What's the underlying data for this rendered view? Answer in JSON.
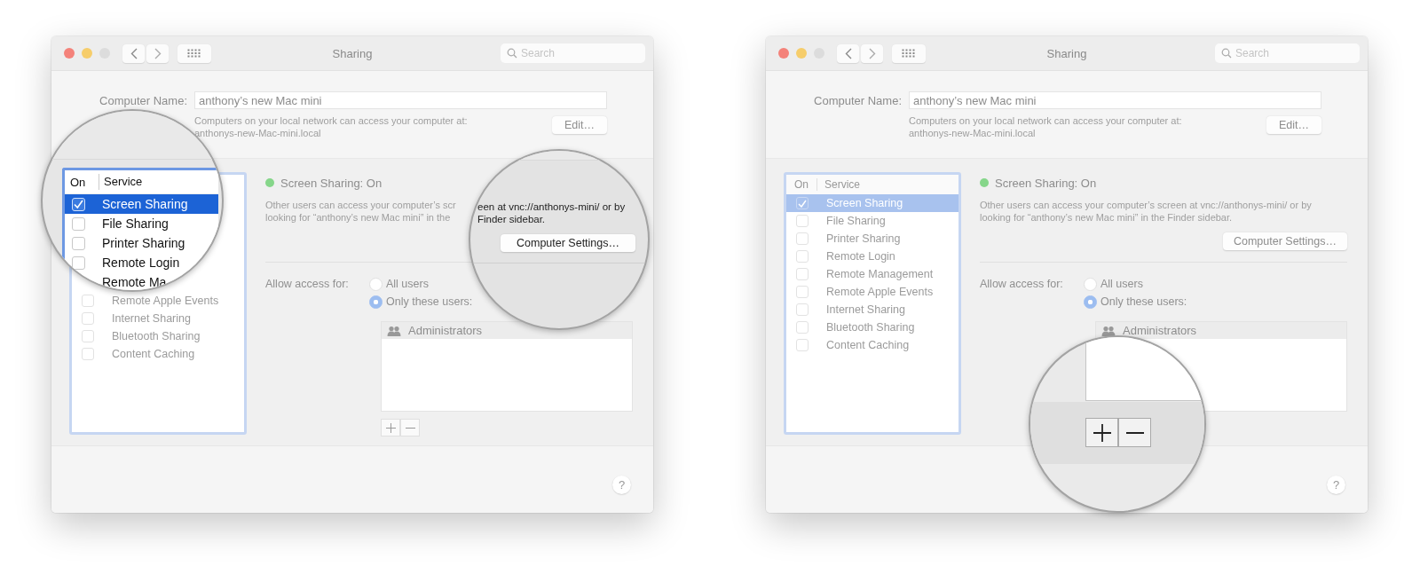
{
  "windows": [
    {
      "title": "Sharing",
      "search": {
        "placeholder": "Search"
      },
      "computer_name": {
        "label": "Computer Name:",
        "value": "anthony’s new Mac mini",
        "note_lines": [
          "Computers on your local network can access your computer at:",
          "anthonys-new-Mac-mini.local"
        ],
        "edit_button": "Edit…"
      },
      "services": {
        "items": [
          {
            "name": "Remote Apple Events",
            "checked": false,
            "selected": false
          },
          {
            "name": "Internet Sharing",
            "checked": false,
            "selected": false
          },
          {
            "name": "Bluetooth Sharing",
            "checked": false,
            "selected": false
          },
          {
            "name": "Content Caching",
            "checked": false,
            "selected": false
          }
        ]
      },
      "status": "Screen Sharing: On",
      "description_lines": [
        "Other users can access your computer’s scr",
        "looking for “anthony’s new Mac mini” in the"
      ],
      "access": {
        "label": "Allow access for:",
        "options": [
          {
            "label": "All users",
            "selected": false
          },
          {
            "label": "Only these users:",
            "selected": true
          }
        ]
      },
      "users": [
        {
          "name": "Administrators"
        }
      ],
      "help": "?",
      "magnifiers": [
        {
          "kind": "services",
          "columns": [
            "On",
            "Service"
          ],
          "items": [
            {
              "name": "Screen Sharing",
              "checked": true,
              "selected": true
            },
            {
              "name": "File Sharing",
              "checked": false,
              "selected": false
            },
            {
              "name": "Printer Sharing",
              "checked": false,
              "selected": false
            },
            {
              "name": "Remote Login",
              "checked": false,
              "selected": false
            },
            {
              "name": "Remote Ma",
              "selected": false
            }
          ]
        },
        {
          "kind": "settings",
          "description_lines": [
            "een at vnc://anthonys-mini/ or by",
            "Finder sidebar."
          ],
          "button": "Computer Settings…"
        }
      ]
    },
    {
      "title": "Sharing",
      "search": {
        "placeholder": "Search"
      },
      "computer_name": {
        "label": "Computer Name:",
        "value": "anthony’s new Mac mini",
        "note_lines": [
          "Computers on your local network can access your computer at:",
          "anthonys-new-Mac-mini.local"
        ],
        "edit_button": "Edit…"
      },
      "services": {
        "columns": [
          "On",
          "Service"
        ],
        "items": [
          {
            "name": "Screen Sharing",
            "checked": true,
            "selected": true
          },
          {
            "name": "File Sharing",
            "checked": false,
            "selected": false
          },
          {
            "name": "Printer Sharing",
            "checked": false,
            "selected": false
          },
          {
            "name": "Remote Login",
            "checked": false,
            "selected": false
          },
          {
            "name": "Remote Management",
            "checked": false,
            "selected": false
          },
          {
            "name": "Remote Apple Events",
            "checked": false,
            "selected": false
          },
          {
            "name": "Internet Sharing",
            "checked": false,
            "selected": false
          },
          {
            "name": "Bluetooth Sharing",
            "checked": false,
            "selected": false
          },
          {
            "name": "Content Caching",
            "checked": false,
            "selected": false
          }
        ]
      },
      "status": "Screen Sharing: On",
      "description_lines": [
        "Other users can access your computer’s screen at vnc://anthonys-mini/ or by",
        "looking for “anthony’s new Mac mini” in the Finder sidebar."
      ],
      "settings_button": "Computer Settings…",
      "access": {
        "label": "Allow access for:",
        "options": [
          {
            "label": "All users",
            "selected": false
          },
          {
            "label": "Only these users:",
            "selected": true
          }
        ]
      },
      "users": [
        {
          "name": "Administrators"
        }
      ],
      "help": "?",
      "magnifiers": [
        {
          "kind": "buttons"
        }
      ]
    }
  ]
}
